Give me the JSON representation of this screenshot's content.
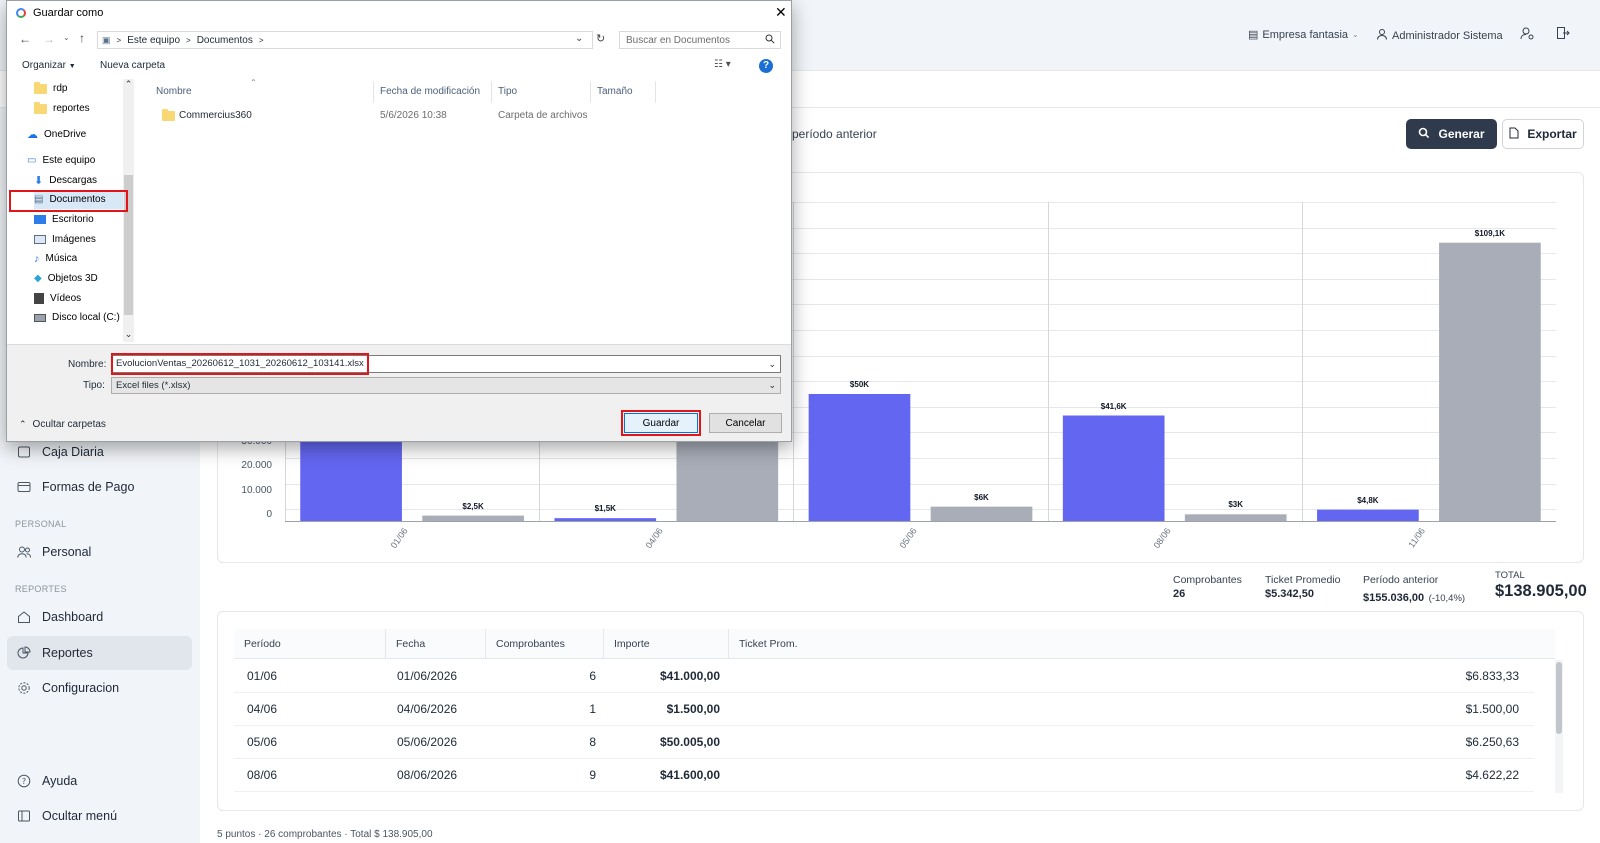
{
  "header": {
    "company": "Empresa fantasia",
    "user": "Administrador Sistema",
    "filter_text": "período anterior",
    "generate_label": "Generar",
    "export_label": "Exportar"
  },
  "sidebar": {
    "items_top": [
      {
        "label": "Caja Diaria"
      },
      {
        "label": "Formas de Pago"
      }
    ],
    "section_personal": "PERSONAL",
    "personal_item": "Personal",
    "section_reportes": "REPORTES",
    "reportes_items": [
      {
        "label": "Dashboard"
      },
      {
        "label": "Reportes"
      },
      {
        "label": "Configuracion"
      }
    ],
    "help": "Ayuda",
    "hide_menu": "Ocultar menú"
  },
  "chart_data": {
    "type": "bar",
    "categories": [
      "01/06",
      "04/06",
      "05/06",
      "08/06",
      "11/06"
    ],
    "series": [
      {
        "color": "#6366f1",
        "values": [
          41000,
          1500,
          50005,
          41600,
          4822
        ]
      },
      {
        "color": "#a8adb8",
        "values": [
          2500,
          43000,
          6000,
          3000,
          109100
        ]
      }
    ],
    "bar_labels_current": [
      "",
      "$1,5K",
      "$50K",
      "$41,6K",
      "$4,8K"
    ],
    "bar_labels_previous": [
      "$2,5K",
      "",
      "$6K",
      "$3K",
      "$109,1K"
    ],
    "y_ticks": [
      "30.000",
      "20.000",
      "10.000",
      "0"
    ],
    "ylim": [
      0,
      125000
    ],
    "grid": true
  },
  "stats": {
    "comprobantes_label": "Comprobantes",
    "comprobantes_value": "26",
    "ticket_label": "Ticket Promedio",
    "ticket_value": "$5.342,50",
    "periodo_label": "Período anterior",
    "periodo_value": "$155.036,00",
    "periodo_change": "(-10,4%)",
    "total_label": "TOTAL",
    "total_value": "$138.905,00"
  },
  "table": {
    "headers": [
      "Período",
      "Fecha",
      "Comprobantes",
      "Importe",
      "Ticket Prom."
    ],
    "rows": [
      {
        "periodo": "01/06",
        "fecha": "01/06/2026",
        "comprobantes": "6",
        "importe": "$41.000,00",
        "ticket": "$6.833,33"
      },
      {
        "periodo": "04/06",
        "fecha": "04/06/2026",
        "comprobantes": "1",
        "importe": "$1.500,00",
        "ticket": "$1.500,00"
      },
      {
        "periodo": "05/06",
        "fecha": "05/06/2026",
        "comprobantes": "8",
        "importe": "$50.005,00",
        "ticket": "$6.250,63"
      },
      {
        "periodo": "08/06",
        "fecha": "08/06/2026",
        "comprobantes": "9",
        "importe": "$41.600,00",
        "ticket": "$4.622,22"
      }
    ]
  },
  "footer": "5 puntos · 26 comprobantes · Total $ 138.905,00",
  "dialog": {
    "title": "Guardar como",
    "path": [
      "Este equipo",
      "Documentos"
    ],
    "search_placeholder": "Buscar en Documentos",
    "organize": "Organizar",
    "new_folder": "Nueva carpeta",
    "nav": [
      {
        "label": "rdp"
      },
      {
        "label": "reportes"
      },
      {
        "label": "OneDrive"
      },
      {
        "label": "Este equipo"
      },
      {
        "label": "Descargas"
      },
      {
        "label": "Documentos"
      },
      {
        "label": "Escritorio"
      },
      {
        "label": "Imágenes"
      },
      {
        "label": "Música"
      },
      {
        "label": "Objetos 3D"
      },
      {
        "label": "Vídeos"
      },
      {
        "label": "Disco local (C:)"
      }
    ],
    "columns": [
      "Nombre",
      "Fecha de modificación",
      "Tipo",
      "Tamaño"
    ],
    "files": [
      {
        "name": "Commercius360",
        "date": "5/6/2026 10:38",
        "type": "Carpeta de archivos"
      }
    ],
    "filename_label": "Nombre:",
    "filename": "EvolucionVentas_20260612_1031_20260612_103141.xlsx",
    "type_label": "Tipo:",
    "type_value": "Excel files (*.xlsx)",
    "hide_folders": "Ocultar carpetas",
    "save": "Guardar",
    "cancel": "Cancelar"
  }
}
